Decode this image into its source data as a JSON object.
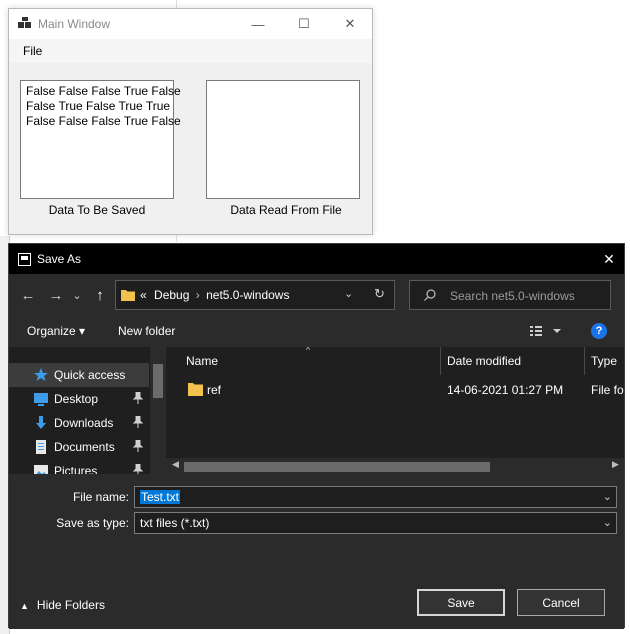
{
  "main_window": {
    "title": "Main Window",
    "controls": {
      "minimize": "—",
      "maximize": "☐",
      "close": "✕"
    },
    "menu": {
      "file": "File"
    },
    "data_to_save": "False False False True False\nFalse True False True True\nFalse False False True False",
    "data_read": "",
    "label_saved": "Data To Be Saved",
    "label_read": "Data Read From File"
  },
  "dialog": {
    "title": "Save As",
    "close": "✕",
    "nav": {
      "back": "←",
      "forward": "→",
      "dropdown": "⌄",
      "up": "↑"
    },
    "address": {
      "overflow": "«",
      "crumbs": [
        "Debug",
        "net5.0-windows"
      ],
      "separator": "›"
    },
    "search": {
      "placeholder": "Search net5.0-windows"
    },
    "toolbar": {
      "organize": "Organize ▾",
      "new_folder": "New folder",
      "help": "?"
    },
    "nav_pane": {
      "items": [
        {
          "label": "Quick access",
          "icon": "star-icon",
          "pinned": false
        },
        {
          "label": "Desktop",
          "icon": "desktop-icon",
          "pinned": true
        },
        {
          "label": "Downloads",
          "icon": "downloads-icon",
          "pinned": true
        },
        {
          "label": "Documents",
          "icon": "documents-icon",
          "pinned": true
        },
        {
          "label": "Pictures",
          "icon": "pictures-icon",
          "pinned": true
        }
      ]
    },
    "file_list": {
      "columns": [
        "Name",
        "Date modified",
        "Type"
      ],
      "rows": [
        {
          "name": "ref",
          "date_modified": "14-06-2021 01:27 PM",
          "type": "File fo"
        }
      ]
    },
    "form": {
      "file_name_label": "File name:",
      "file_name_value": "Test.txt",
      "save_as_type_label": "Save as type:",
      "save_as_type_value": "txt files (*.txt)"
    },
    "hide_folders": "Hide Folders",
    "save_button": "Save",
    "cancel_button": "Cancel"
  },
  "colors": {
    "dialog_bg": "#2b2b2b",
    "pane_bg": "#1f1f1f",
    "selection": "#0078d7",
    "folder": "#f2c14e"
  }
}
